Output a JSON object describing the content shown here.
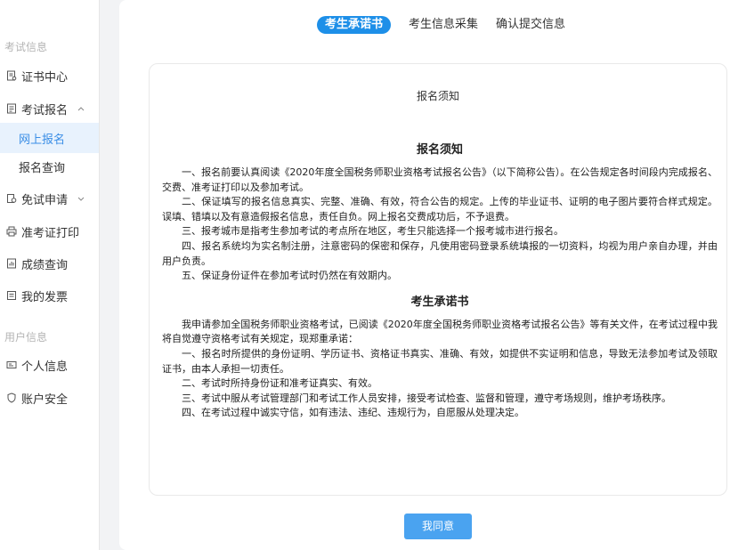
{
  "sidebar": {
    "section1_title": "考试信息",
    "section2_title": "用户信息",
    "items": [
      {
        "label": "证书中心",
        "icon": "certificate-icon"
      },
      {
        "label": "考试报名",
        "icon": "document-icon",
        "expanded": true
      },
      {
        "label": "免试申请",
        "icon": "settings-icon",
        "expanded": false
      },
      {
        "label": "准考证打印",
        "icon": "printer-icon"
      },
      {
        "label": "成绩查询",
        "icon": "scores-icon"
      },
      {
        "label": "我的发票",
        "icon": "invoice-icon"
      },
      {
        "label": "个人信息",
        "icon": "id-card-icon"
      },
      {
        "label": "账户安全",
        "icon": "shield-icon"
      }
    ],
    "subitems": [
      {
        "label": "网上报名",
        "active": true
      },
      {
        "label": "报名查询",
        "active": false
      }
    ]
  },
  "steps": [
    {
      "label": "考生承诺书",
      "active": true
    },
    {
      "label": "考生信息采集",
      "active": false
    },
    {
      "label": "确认提交信息",
      "active": false
    }
  ],
  "notice": {
    "header": "报名须知",
    "title1": "报名须知",
    "paragraphs1": [
      "一、报名前要认真阅读《2020年度全国税务师职业资格考试报名公告》（以下简称公告）。在公告规定各时间段内完成报名、交费、准考证打印以及参加考试。",
      "二、保证填写的报名信息真实、完整、准确、有效，符合公告的规定。上传的毕业证书、证明的电子图片要符合样式规定。误填、错填以及有意造假报名信息，责任自负。网上报名交费成功后，不予退费。",
      "三、报考城市是指考生参加考试的考点所在地区，考生只能选择一个报考城市进行报名。",
      "四、报名系统均为实名制注册，注意密码的保密和保存，凡使用密码登录系统填报的一切资料，均视为用户亲自办理，并由用户负责。",
      "五、保证身份证件在参加考试时仍然在有效期内。"
    ],
    "title2": "考生承诺书",
    "paragraphs2": [
      "我申请参加全国税务师职业资格考试，已阅读《2020年度全国税务师职业资格考试报名公告》等有关文件，在考试过程中我将自觉遵守资格考试有关规定，现郑重承诺：",
      "一、报名时所提供的身份证明、学历证书、资格证书真实、准确、有效，如提供不实证明和信息，导致无法参加考试及领取证书，由本人承担一切责任。",
      "二、考试时所持身份证和准考证真实、有效。",
      "三、考试中服从考试管理部门和考试工作人员安排，接受考试检查、监督和管理，遵守考场规则，维护考场秩序。",
      "四、在考试过程中诚实守信，如有违法、违纪、违规行为，自愿服从处理决定。"
    ]
  },
  "agree_button": "我同意",
  "colors": {
    "accent": "#1d8fe8",
    "button": "#4aa3f0",
    "active_bg": "#e8f2fd",
    "active_text": "#3a8ee6"
  }
}
